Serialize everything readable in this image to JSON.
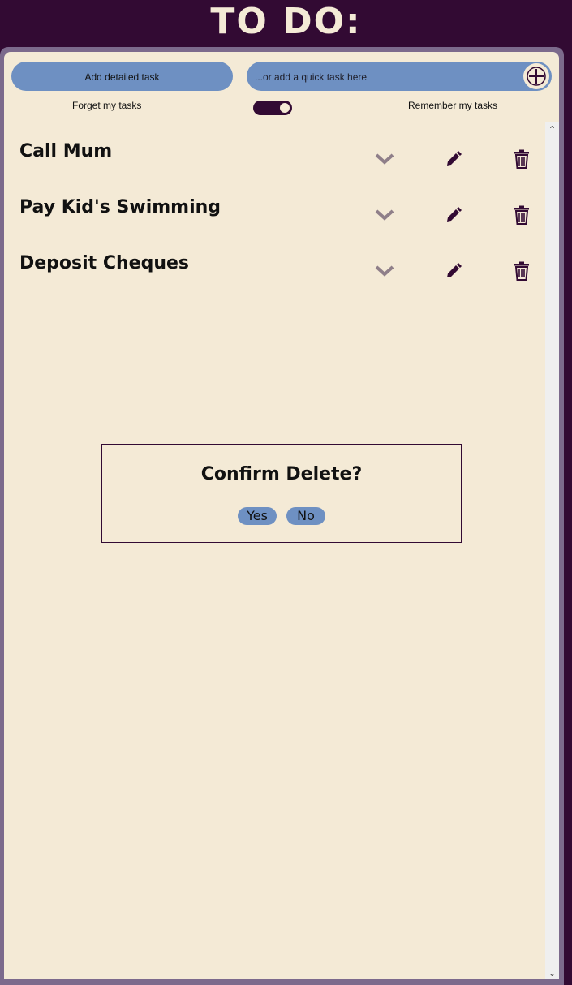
{
  "app": {
    "title": "TO DO:"
  },
  "toolbar": {
    "detailed_label": "Add detailed task",
    "quick_placeholder": "...or add a quick task here",
    "add_icon": "plus-icon"
  },
  "storage_toggle": {
    "off_label": "Forget my tasks",
    "on_label": "Remember my tasks",
    "state": "on"
  },
  "tasks": [
    {
      "title": "Call Mum"
    },
    {
      "title": "Pay Kid's Swimming"
    },
    {
      "title": "Deposit Cheques"
    }
  ],
  "task_icons": {
    "expand": "chevron-down-icon",
    "edit": "pencil-icon",
    "delete": "trash-icon"
  },
  "confirm_dialog": {
    "title": "Confirm Delete?",
    "yes_label": "Yes",
    "no_label": "No"
  },
  "colors": {
    "background": "#320a33",
    "panel": "#f4ead6",
    "accent": "#6e90c2",
    "frame": "#7c6a8c",
    "chevron": "#8f7f89"
  }
}
